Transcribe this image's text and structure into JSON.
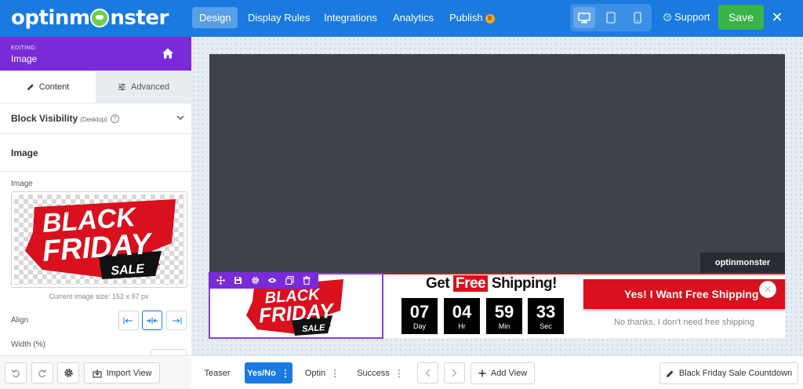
{
  "app": {
    "logo_text": "optinmonster"
  },
  "topnav": {
    "items": [
      {
        "label": "Design"
      },
      {
        "label": "Display Rules"
      },
      {
        "label": "Integrations"
      },
      {
        "label": "Analytics"
      },
      {
        "label": "Publish"
      }
    ],
    "active": "Design",
    "devices": [
      "desktop-icon",
      "tablet-icon",
      "mobile-icon"
    ],
    "active_device": "desktop-icon",
    "support_label": "Support",
    "save_label": "Save"
  },
  "editor": {
    "editing_kicker": "EDITING:",
    "editing_title": "Image",
    "tabs": [
      {
        "label": "Content"
      },
      {
        "label": "Advanced"
      }
    ],
    "active_tab": "Content",
    "block_visibility_label": "Block Visibility",
    "block_visibility_device": "(Desktop)",
    "section_title": "Image",
    "image_field_label": "Image",
    "current_size": "Current image size: 152 x 97 px",
    "align_label": "Align",
    "align_options": [
      "left",
      "center",
      "right"
    ],
    "align_selected": "center",
    "width_label": "Width (%)"
  },
  "left_toolbar": {
    "import_view_label": "Import View"
  },
  "campaign": {
    "credit": "optinmonster",
    "image_text": {
      "line1": "BLACK",
      "line2": "FRIDAY",
      "line3": "SALE"
    },
    "headline_pre": "Get",
    "headline_free": "Free",
    "headline_post": "Shipping!",
    "countdown": [
      {
        "num": "07",
        "unit": "Day"
      },
      {
        "num": "04",
        "unit": "Hr"
      },
      {
        "num": "59",
        "unit": "Min"
      },
      {
        "num": "33",
        "unit": "Sec"
      }
    ],
    "cta_label": "Yes! I Want Free Shipping",
    "close_glyph": "×",
    "decline_label": "No thanks, I don't need free shipping"
  },
  "views": {
    "items": [
      {
        "label": "Teaser"
      },
      {
        "label": "Yes/No"
      },
      {
        "label": "Optin"
      },
      {
        "label": "Success"
      }
    ],
    "active": "Yes/No",
    "add_view_label": "Add View",
    "campaign_name": "Black Friday Sale Countdown"
  },
  "colors": {
    "brand_blue": "#1a7ae0",
    "editor_purple": "#7a2bd8",
    "save_green": "#38b44a",
    "promo_red": "#d9101d"
  }
}
